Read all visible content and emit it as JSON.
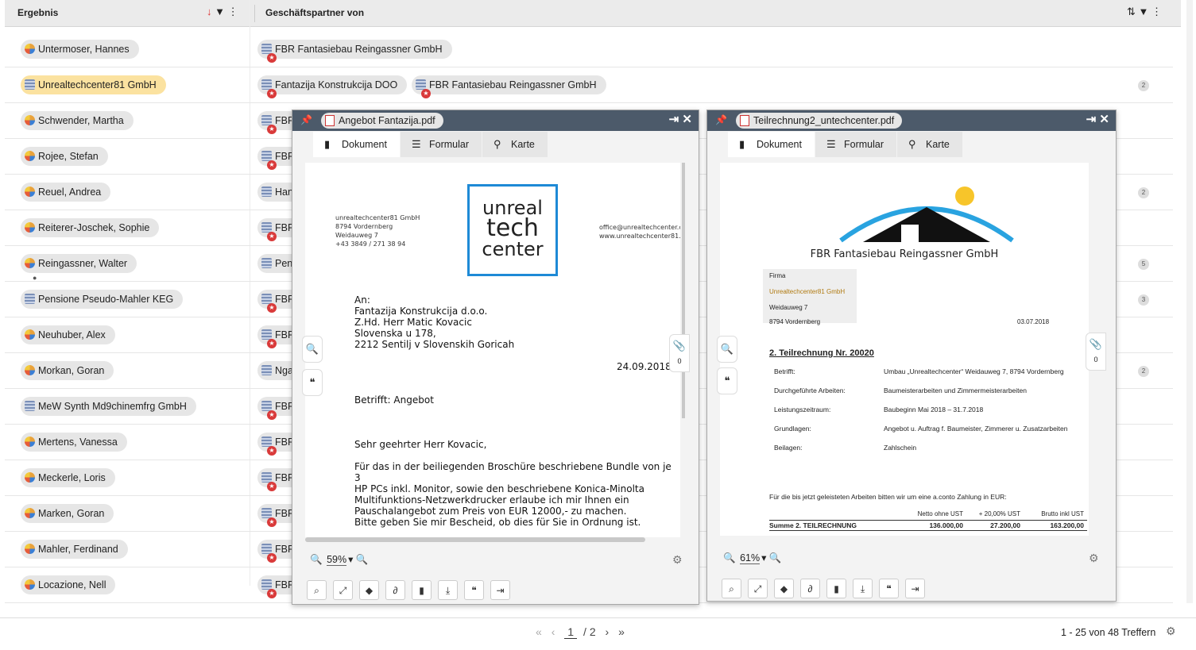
{
  "header": {
    "col1": "Ergebnis",
    "col2": "Geschäftspartner von"
  },
  "rows": [
    {
      "name": "Untermoser, Hannes",
      "partners": [
        "FBR Fantasiebau Reingassner GmbH"
      ],
      "count": ""
    },
    {
      "name": "Unrealtechcenter81 GmbH",
      "partners": [
        "Fantazija Konstrukcija DOO",
        "FBR Fantasiebau Reingassner GmbH"
      ],
      "count": "2"
    },
    {
      "name": "Schwender, Martha",
      "partners": [
        "FBR"
      ],
      "count": ""
    },
    {
      "name": "Rojee, Stefan",
      "partners": [
        "FBR"
      ],
      "count": ""
    },
    {
      "name": "Reuel, Andrea",
      "partners": [
        "Han"
      ],
      "count": "2"
    },
    {
      "name": "Reiterer-Joschek, Sophie",
      "partners": [
        "FBR"
      ],
      "count": ""
    },
    {
      "name": "Reingassner, Walter",
      "partners": [
        "Pen"
      ],
      "count": "5"
    },
    {
      "name": "Pensione Pseudo-Mahler KEG",
      "partners": [
        "FBR"
      ],
      "count": "3"
    },
    {
      "name": "Neuhuber, Alex",
      "partners": [
        "FBR"
      ],
      "count": ""
    },
    {
      "name": "Morkan, Goran",
      "partners": [
        "Nga"
      ],
      "count": "2"
    },
    {
      "name": "MeW Synth Md9chinemfrg GmbH",
      "partners": [
        "FBR"
      ],
      "count": ""
    },
    {
      "name": "Mertens, Vanessa",
      "partners": [
        "FBR"
      ],
      "count": ""
    },
    {
      "name": "Meckerle, Loris",
      "partners": [
        "FBR"
      ],
      "count": ""
    },
    {
      "name": "Marken, Goran",
      "partners": [
        "FBR"
      ],
      "count": ""
    },
    {
      "name": "Mahler, Ferdinand",
      "partners": [
        "FBR"
      ],
      "count": ""
    },
    {
      "name": "Locazione, Nell",
      "partners": [
        "FBR"
      ],
      "count": ""
    }
  ],
  "pager": {
    "first": "«",
    "prev": "‹",
    "current": "1",
    "total": "/ 2",
    "next": "›",
    "last": "»",
    "hits": "1 - 25 von 48 Treffern"
  },
  "viewer1": {
    "filename": "Angebot Fantazija.pdf",
    "tabs": [
      "Dokument",
      "Formular",
      "Karte"
    ],
    "zoom": "59%",
    "attach_count": "0",
    "doc": {
      "sender": "unrealtechcenter81 GmbH\n8794 Vordernberg\nWeidauweg 7\n+43 3849 / 271 38 94",
      "logo": [
        "unreal",
        "tech",
        "center"
      ],
      "contact": "office@unrealtechcenter.c\nwww.unrealtechcenter81.c",
      "address": "An:\nFantazija Konstrukcija d.o.o.\nZ.Hd. Herr Matic Kovacic\nSlovenska u  178,\n2212 Sentilj v Slovenskih  Goricah",
      "date": "24.09.2018",
      "subject": "Betrifft: Angebot",
      "salutation": "Sehr geehrter Herr Kovacic,",
      "body": "Für das in der beiliegenden Broschüre beschriebene Bundle von je 3\nHP PCs inkl. Monitor, sowie den beschriebene Konica-Minolta\nMultifunktions-Netzwerkdrucker erlaube ich mir Ihnen ein\nPauschalangebot zum Preis von EUR 12000,- zu machen.\nBitte geben Sie mir Bescheid, ob dies für Sie in Ordnung ist."
    }
  },
  "viewer2": {
    "filename": "Teilrechnung2_untechcenter.pdf",
    "tabs": [
      "Dokument",
      "Formular",
      "Karte"
    ],
    "zoom": "61%",
    "attach_count": "0",
    "doc": {
      "company": "FBR Fantasiebau Reingassner GmbH",
      "firm_label": "Firma",
      "firm_name": "Unrealtechcenter81 GmbH",
      "firm_street": "Weidauweg 7",
      "firm_city": "8794 Vordernberg",
      "date": "03.07.2018",
      "title": "2. Teilrechnung Nr. 20020",
      "fields": [
        {
          "label": "Betrifft:",
          "value": "Umbau „Unrealtechcenter“ Weidauweg 7, 8794 Vordernberg"
        },
        {
          "label": "Durchgeführte Arbeiten:",
          "value": "Baumeisterarbeiten und Zimmermeisterarbeiten"
        },
        {
          "label": "Leistungszeitraum:",
          "value": "Baubeginn Mai 2018 – 31.7.2018"
        },
        {
          "label": "Grundlagen:",
          "value": "Angebot u. Auftrag f. Baumeister, Zimmerer u. Zusatzarbeiten"
        },
        {
          "label": "Beilagen:",
          "value": "Zahlschein"
        }
      ],
      "note": "Für die bis jetzt geleisteten Arbeiten bitten wir um eine a.conto Zahlung in EUR:",
      "table_headers": [
        "Netto ohne UST",
        "+ 20,00% UST",
        "Brutto inkl UST"
      ],
      "sum_label": "Summe 2. TEILRECHNUNG",
      "sum_values": [
        "136.000,00",
        "27.200,00",
        "163.200,00"
      ]
    }
  }
}
